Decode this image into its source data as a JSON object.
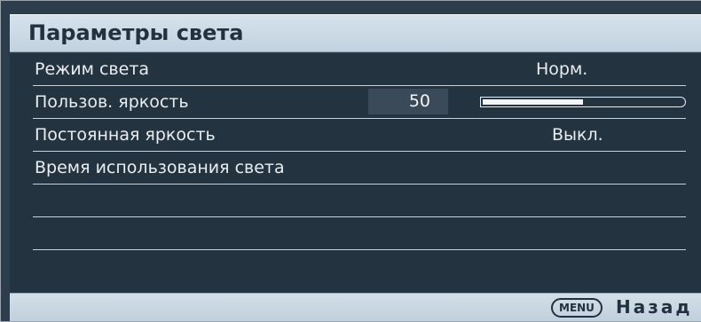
{
  "menu": {
    "title": "Параметры света",
    "items": [
      {
        "label": "Режим света",
        "value": "Норм."
      },
      {
        "label": "Пользов. яркость",
        "value": "50",
        "slider_fraction": 0.5
      },
      {
        "label": "Постоянная яркость",
        "value": "Выкл."
      },
      {
        "label": "Время использования света",
        "value": ""
      },
      {
        "label": "",
        "value": ""
      },
      {
        "label": "",
        "value": ""
      }
    ]
  },
  "footer": {
    "key_label": "MENU",
    "back_label": "Назад"
  },
  "colors": {
    "panel_bg": "#243340",
    "header_bg": "#c8d7e3",
    "text": "#e9edf0",
    "header_text": "#22313f"
  }
}
